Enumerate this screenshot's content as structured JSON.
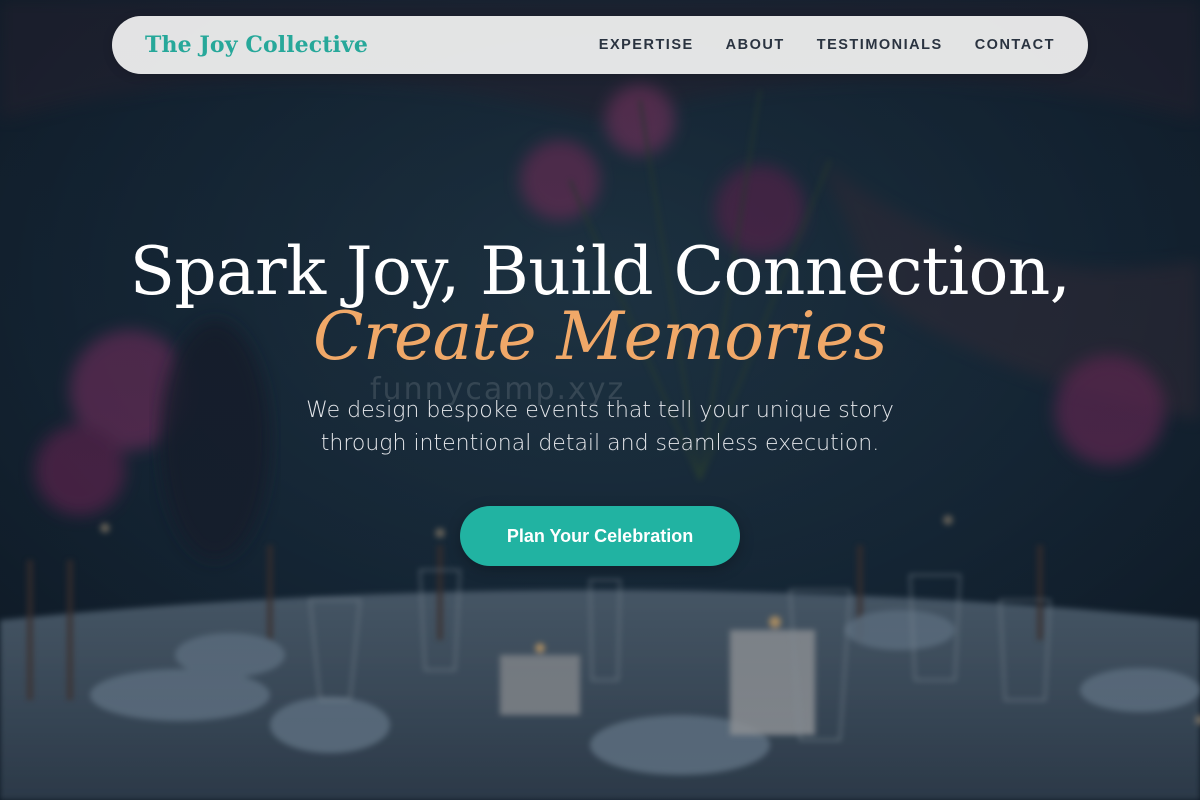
{
  "nav": {
    "brand": "The Joy Collective",
    "links": [
      "EXPERTISE",
      "ABOUT",
      "TESTIMONIALS",
      "CONTACT"
    ]
  },
  "hero": {
    "title_line1": "Spark Joy, Build Connection,",
    "title_line2": "Create Memories",
    "subtitle_line1": "We design bespoke events that tell your unique story",
    "subtitle_line2": "through intentional detail and seamless execution.",
    "cta_label": "Plan Your Celebration"
  },
  "watermark": "funnycamp.xyz",
  "colors": {
    "brand": "#27a89a",
    "accent": "#f0a868",
    "cta": "#21b3a2",
    "nav_background": "#f0f0f0"
  }
}
